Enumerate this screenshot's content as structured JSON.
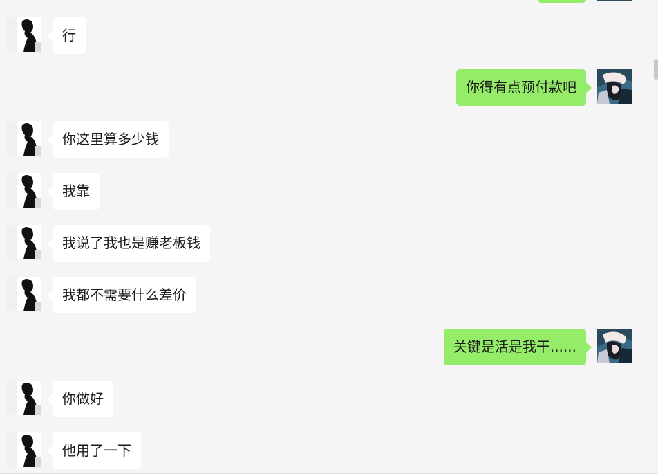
{
  "colors": {
    "background": "#f5f5f5",
    "incoming_bubble": "#ffffff",
    "outgoing_bubble": "#95ec69",
    "text": "#191919"
  },
  "avatars": {
    "contact": "contact-avatar-icon",
    "self": "self-avatar-icon"
  },
  "messages": [
    {
      "side": "in",
      "text": "行"
    },
    {
      "side": "out",
      "text": "你得有点预付款吧"
    },
    {
      "side": "in",
      "text": "你这里算多少钱"
    },
    {
      "side": "in",
      "text": "我靠"
    },
    {
      "side": "in",
      "text": "我说了我也是赚老板钱"
    },
    {
      "side": "in",
      "text": "我都不需要什么差价"
    },
    {
      "side": "out",
      "text": "关键是活是我干......"
    },
    {
      "side": "in",
      "text": "你做好"
    },
    {
      "side": "in",
      "text": "他用了一下"
    }
  ]
}
